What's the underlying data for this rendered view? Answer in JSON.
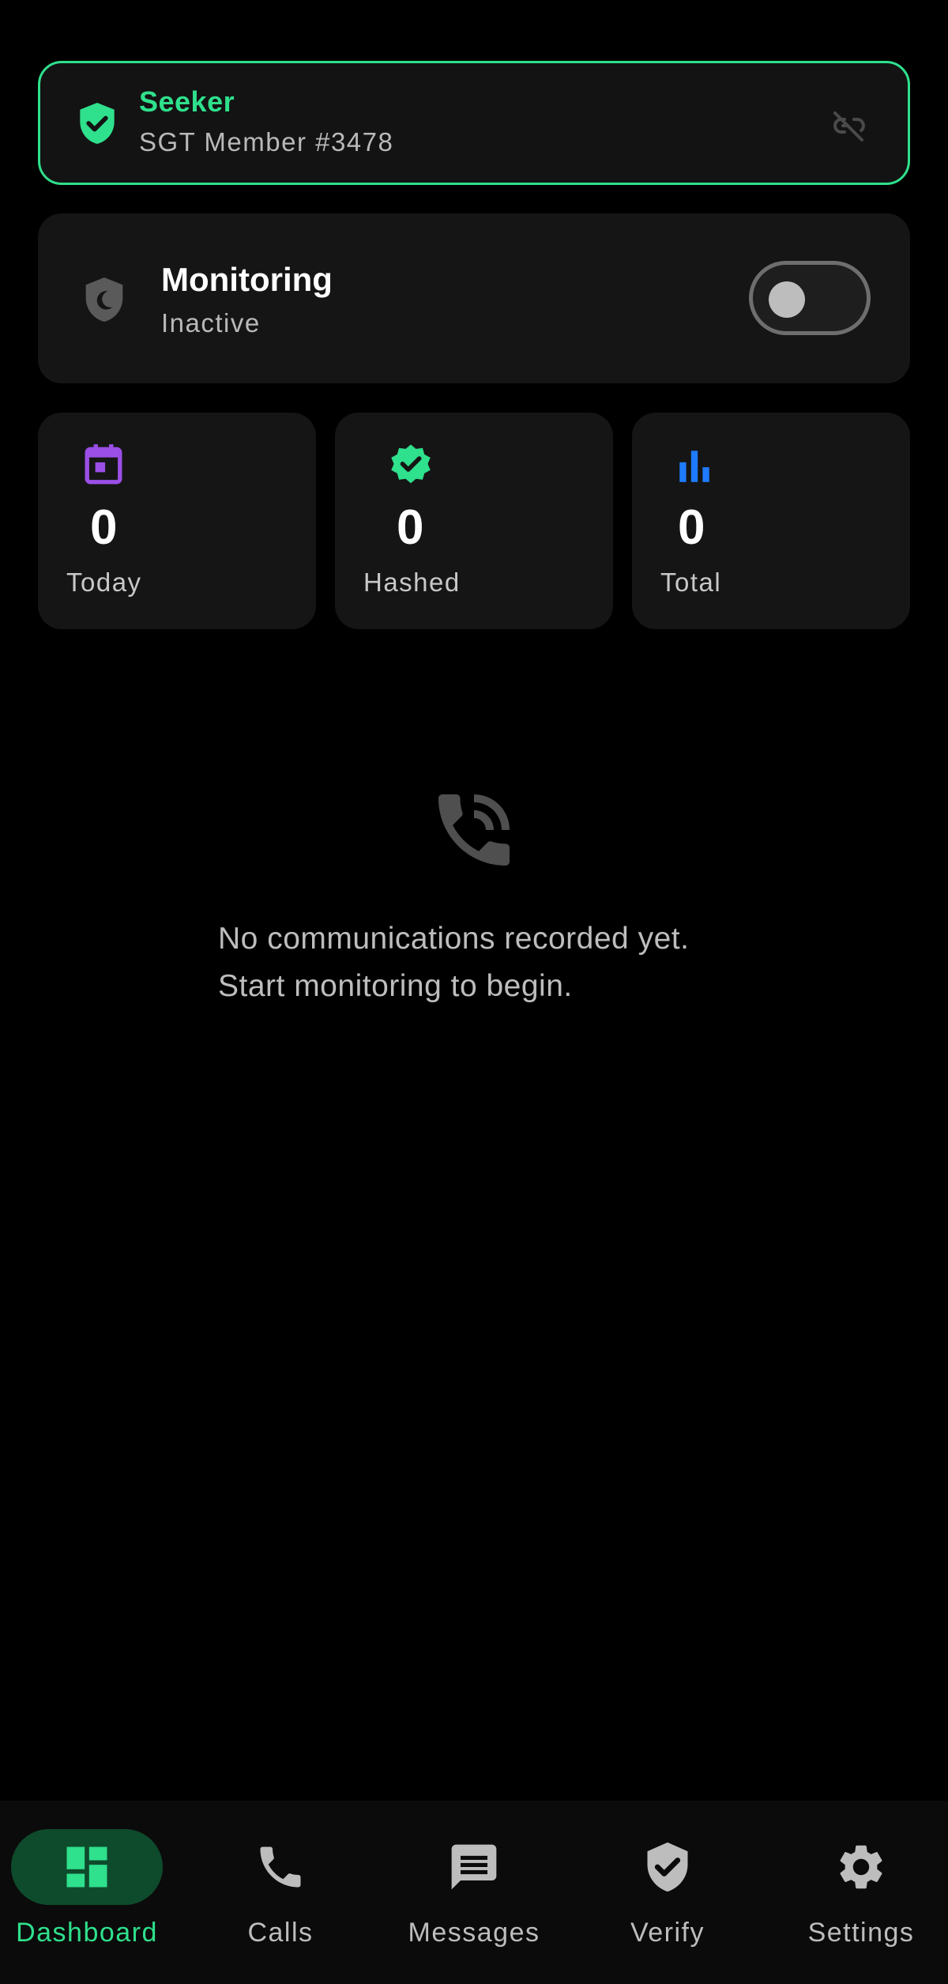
{
  "member": {
    "title": "Seeker",
    "subtitle": "SGT Member #3478",
    "icon": "verified-shield-icon",
    "unlink_icon": "link-off-icon"
  },
  "monitoring": {
    "title": "Monitoring",
    "status": "Inactive",
    "enabled": false,
    "icon": "shield-moon-icon"
  },
  "stats": [
    {
      "value": "0",
      "label": "Today",
      "icon": "calendar-icon",
      "color": "#9b4fe6"
    },
    {
      "value": "0",
      "label": "Hashed",
      "icon": "verified-badge-icon",
      "color": "#2fe08c"
    },
    {
      "value": "0",
      "label": "Total",
      "icon": "bar-chart-icon",
      "color": "#1e7bff"
    }
  ],
  "empty_state": {
    "icon": "phone-in-talk-icon",
    "message": "No communications recorded yet.\nStart monitoring to begin."
  },
  "nav": {
    "items": [
      {
        "label": "Dashboard",
        "icon": "dashboard-icon",
        "active": true
      },
      {
        "label": "Calls",
        "icon": "phone-icon",
        "active": false
      },
      {
        "label": "Messages",
        "icon": "message-icon",
        "active": false
      },
      {
        "label": "Verify",
        "icon": "verify-shield-icon",
        "active": false
      },
      {
        "label": "Settings",
        "icon": "gear-icon",
        "active": false
      }
    ]
  },
  "colors": {
    "accent": "#2fe08c",
    "background": "#000000",
    "card": "#151515",
    "nav_active_bg": "#0e4a2c"
  }
}
